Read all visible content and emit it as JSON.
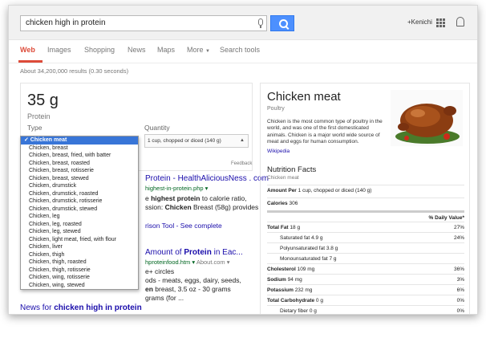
{
  "search": {
    "query": "chicken high in protein"
  },
  "header": {
    "user": "+Kenichi"
  },
  "nav": {
    "tabs": [
      {
        "label": "Web"
      },
      {
        "label": "Images"
      },
      {
        "label": "Shopping"
      },
      {
        "label": "News"
      },
      {
        "label": "Maps"
      },
      {
        "label": "More"
      },
      {
        "label": "Search tools"
      }
    ]
  },
  "stats": "About 34,200,000 results (0.30 seconds)",
  "answer": {
    "value": "35 g",
    "nutrient": "Protein",
    "type_label": "Type",
    "quantity_label": "Quantity",
    "quantity_value": "1 cup, chopped or diced (140 g)",
    "feedback": "Feedback"
  },
  "type_options": [
    "✓ Chicken meat",
    "Chicken, breast",
    "Chicken, breast, fried, with batter",
    "Chicken, breast, roasted",
    "Chicken, breast, rotisserie",
    "Chicken, breast, stewed",
    "Chicken, drumstick",
    "Chicken, drumstick, roasted",
    "Chicken, drumstick, rotisserie",
    "Chicken, drumstick, stewed",
    "Chicken, leg",
    "Chicken, leg, roasted",
    "Chicken, leg, stewed",
    "Chicken, light meat, fried, with flour",
    "Chicken, liver",
    "Chicken, thigh",
    "Chicken, thigh, roasted",
    "Chicken, thigh, rotisserie",
    "Chicken, wing, rotisserie",
    "Chicken, wing, stewed"
  ],
  "results": {
    "r1_title_tail": "Protein - HealthAliciousNess . com",
    "r1_url_tail": "highest-in-protein.php",
    "r1_line1_a": "e ",
    "r1_line1_b": "highest protein",
    "r1_line1_c": " to calorie ratio,",
    "r1_line2_a": "ssion: ",
    "r1_line2_b": "Chicken",
    "r1_line2_c": " Breast (58g) provides",
    "r1_sub_link": "rison Tool - See complete",
    "r2_title_a": "Amount of ",
    "r2_title_b": "Protein",
    "r2_title_c": " in Eac...",
    "r2_url": "hproteinfood.htm",
    "r2_url_site": "About.com",
    "r2_l1": "e+ circles",
    "r2_l2": "ods - meats, eggs, dairy, seeds,",
    "r2_l3_a": "en",
    "r2_l3_b": " breast, 3.5 oz - 30 grams",
    "r2_l4": "grams (for ...",
    "news_a": "News for ",
    "news_b": "chicken high in protein"
  },
  "panel": {
    "title": "Chicken meat",
    "subtitle": "Poultry",
    "description": "Chicken is the most common type of poultry in the world, and was one of the first domesticated animals. Chicken is a major world wide source of meat and eggs for human consumption.",
    "wiki": "Wikipedia",
    "nf_title": "Nutrition Facts",
    "nf_subtitle": "Chicken meat",
    "amount_label": "Amount Per",
    "amount_value": "1 cup, chopped or diced (140 g)",
    "calories_label": "Calories",
    "calories_value": "306",
    "dv_header": "% Daily Value*",
    "rows": [
      {
        "label": "Total Fat",
        "value": "18 g",
        "pct": "27%",
        "bold": true
      },
      {
        "label": "Saturated fat",
        "value": "4.9 g",
        "pct": "24%",
        "bold": false
      },
      {
        "label": "Polyunsaturated fat",
        "value": "3.8 g",
        "pct": "",
        "bold": false
      },
      {
        "label": "Monounsaturated fat",
        "value": "7 g",
        "pct": "",
        "bold": false
      },
      {
        "label": "Cholesterol",
        "value": "109 mg",
        "pct": "36%",
        "bold": true
      },
      {
        "label": "Sodium",
        "value": "94 mg",
        "pct": "3%",
        "bold": true
      },
      {
        "label": "Potassium",
        "value": "232 mg",
        "pct": "6%",
        "bold": true
      },
      {
        "label": "Total Carbohydrate",
        "value": "0 g",
        "pct": "0%",
        "bold": true
      },
      {
        "label": "Dietary fiber",
        "value": "0 g",
        "pct": "0%",
        "bold": false
      }
    ]
  },
  "colors": {
    "accent": "#dd4b39",
    "link": "#1a0dab",
    "button": "#4d90fe",
    "url": "#006621"
  }
}
